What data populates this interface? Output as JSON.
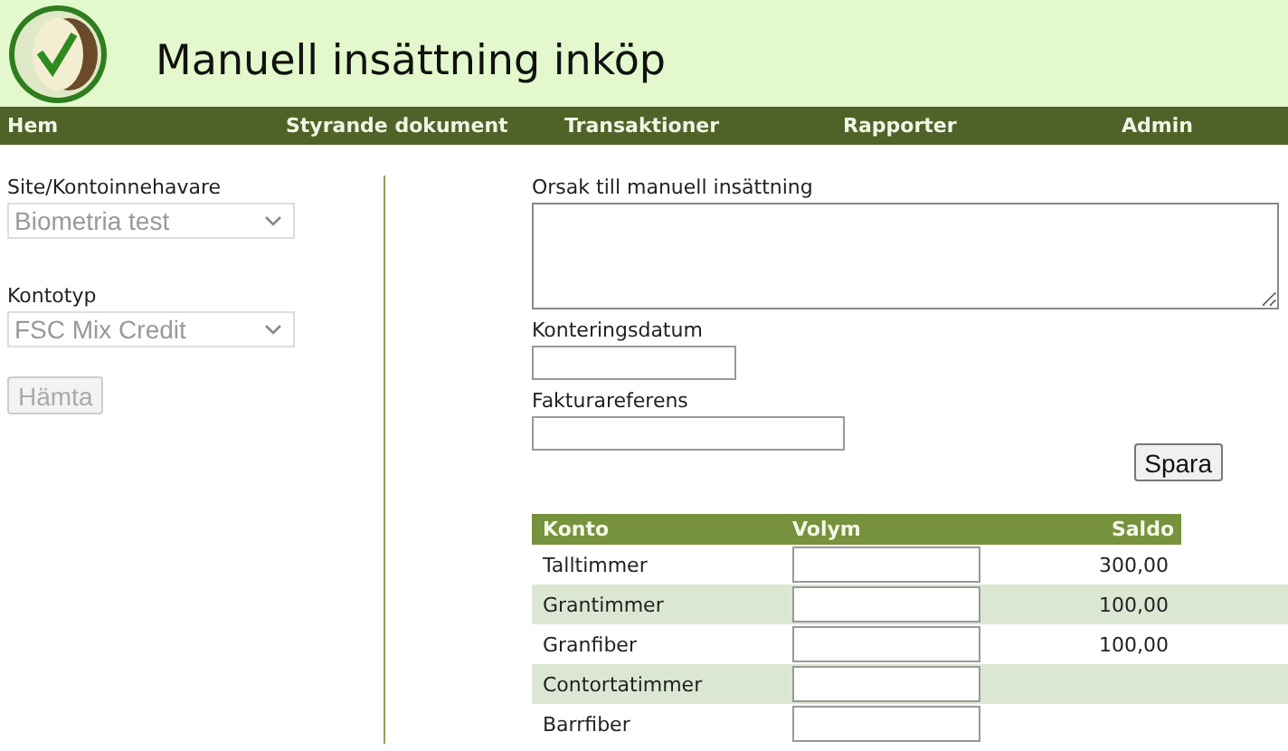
{
  "header": {
    "title": "Manuell insättning inköp"
  },
  "nav": [
    {
      "label": "Hem"
    },
    {
      "label": "Styrande dokument"
    },
    {
      "label": "Transaktioner"
    },
    {
      "label": "Rapporter"
    },
    {
      "label": "Admin"
    }
  ],
  "filters": [
    {
      "label": "Site/Kontoinnehavare",
      "value": "Biometria test",
      "disabled": true
    },
    {
      "label": "Kontotyp",
      "value": "FSC Mix Credit",
      "disabled": true
    }
  ],
  "fetch_button": {
    "label": "Hämta",
    "disabled": true
  },
  "form": {
    "reason_label": "Orsak till manuell insättning",
    "date_label": "Konteringsdatum",
    "invoice_label": "Fakturareferens",
    "save_button": "Spara"
  },
  "table": {
    "columns": [
      "Konto",
      "Volym",
      "Saldo"
    ],
    "rows": [
      {
        "account": "Talltimmer",
        "balance": "300,00"
      },
      {
        "account": "Grantimmer",
        "balance": "100,00"
      },
      {
        "account": "Granfiber",
        "balance": "100,00"
      },
      {
        "account": "Contortatimmer"
      },
      {
        "account": "Barrfiber"
      }
    ]
  }
}
